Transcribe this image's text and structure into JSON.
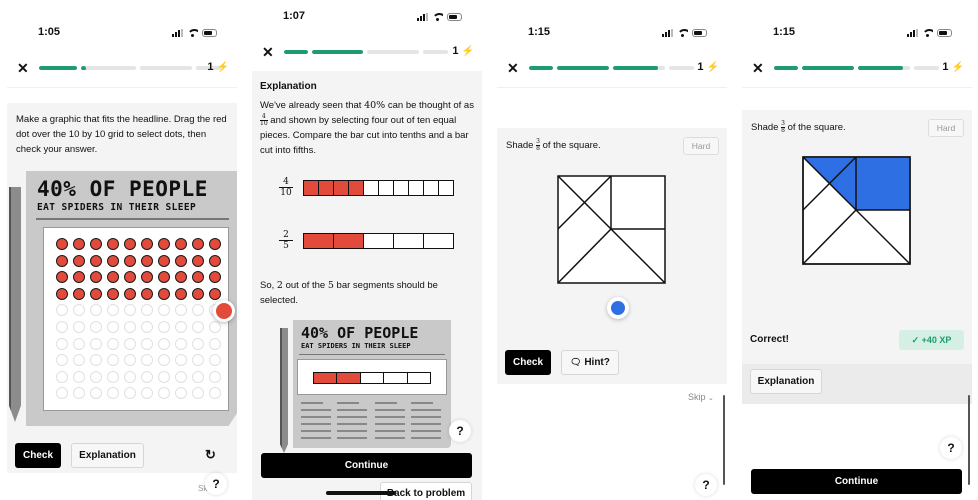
{
  "screens": [
    {
      "time": "1:05",
      "streak": "1",
      "progress": [
        1.0,
        0.06,
        0.0,
        0.0
      ],
      "prompt": "Make a graphic that fits the headline. Drag the red dot over the 10 by 10 grid to select dots, then check your answer.",
      "headline": "40% OF PEOPLE",
      "subheadline": "EAT SPIDERS IN THEIR SLEEP",
      "grid": {
        "rows": 10,
        "cols": 10,
        "selected": 40
      },
      "buttons": {
        "check": "Check",
        "explanation": "Explanation",
        "reset_icon": "reset-icon"
      },
      "skip_label": "Skip",
      "help": "?"
    },
    {
      "time": "1:07",
      "streak": "1",
      "progress": [
        1.0,
        1.0,
        0.0,
        0.0
      ],
      "explanation_title": "Explanation",
      "explanation_text": "We've already seen that 40% can be thought of as 4/10 and shown by selecting four out of ten equal pieces. Compare the bar cut into tenths and a bar cut into fifths.",
      "text_parts": {
        "p1": "We've already seen that ",
        "pct": "40%",
        "p2": " can be thought of as ",
        "num": "4",
        "den": "10",
        "p3": " and shown by selecting four out of ten equal pieces. Compare the bar cut into tenths and a bar cut into fifths."
      },
      "bars": [
        {
          "num": "4",
          "den": "10",
          "segments": 10,
          "selected": 4
        },
        {
          "num": "2",
          "den": "5",
          "segments": 5,
          "selected": 2
        }
      ],
      "conclusion": "So, 2 out of the 5 bar segments should be selected.",
      "conclusion_parts": {
        "p1": "So, ",
        "n": "2",
        "p2": " out of the ",
        "d": "5",
        "p3": " bar segments should be selected."
      },
      "headline": "40% OF PEOPLE",
      "subheadline": "EAT SPIDERS IN THEIR SLEEP",
      "news_bar": {
        "segments": 5,
        "selected": 2
      },
      "continue": "Continue",
      "back": "Back to problem",
      "help": "?"
    },
    {
      "time": "1:15",
      "streak": "1",
      "progress": [
        1.0,
        1.0,
        0.87,
        0.0
      ],
      "prompt_pre": "Shade ",
      "frac_num": "3",
      "frac_den": "8",
      "prompt_post": " of the square.",
      "difficulty": "Hard",
      "buttons": {
        "check": "Check",
        "hint": "Hint?"
      },
      "skip_label": "Skip",
      "help": "?",
      "drag_handle_color": "#2f6fe4"
    },
    {
      "time": "1:15",
      "streak": "1",
      "progress": [
        1.0,
        1.0,
        0.87,
        0.0
      ],
      "prompt_pre": "Shade ",
      "frac_num": "3",
      "frac_den": "8",
      "prompt_post": " of the square.",
      "difficulty": "Hard",
      "shaded_fraction": "3/8",
      "result": "Correct!",
      "xp": "+40 XP",
      "explanation": "Explanation",
      "continue": "Continue",
      "help": "?",
      "shade_color": "#2f6fe4"
    }
  ],
  "colors": {
    "accent_green": "#1e9b72",
    "red": "#e24b3b",
    "blue": "#2f6fe4",
    "bolt": "#f5b731"
  }
}
